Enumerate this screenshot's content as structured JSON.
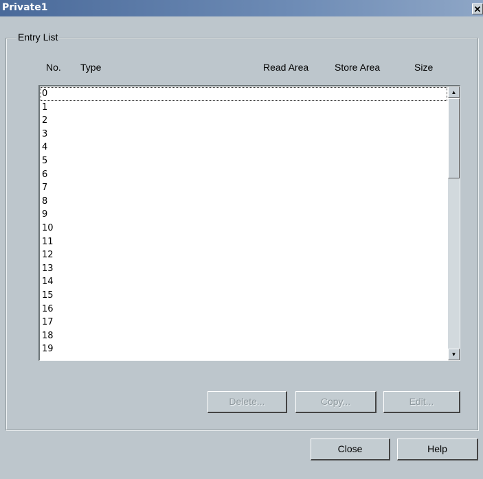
{
  "window": {
    "title": "Private1",
    "close_glyph": "✕"
  },
  "group": {
    "label": "Entry List"
  },
  "columns": [
    "No.",
    "Type",
    "Read Area",
    "Store Area",
    "Size"
  ],
  "entries": [
    "0",
    "1",
    "2",
    "3",
    "4",
    "5",
    "6",
    "7",
    "8",
    "9",
    "10",
    "11",
    "12",
    "13",
    "14",
    "15",
    "16",
    "17",
    "18",
    "19"
  ],
  "scrollbar": {
    "up_icon": "up-arrow-icon",
    "down_icon": "down-arrow-icon"
  },
  "buttons": {
    "delete": "Delete...",
    "copy": "Copy...",
    "edit": "Edit...",
    "close": "Close",
    "help": "Help"
  },
  "colors": {
    "background": "#bdc6cc",
    "title_bar": "#4a6a9a",
    "disabled_text": "#8f999e"
  }
}
